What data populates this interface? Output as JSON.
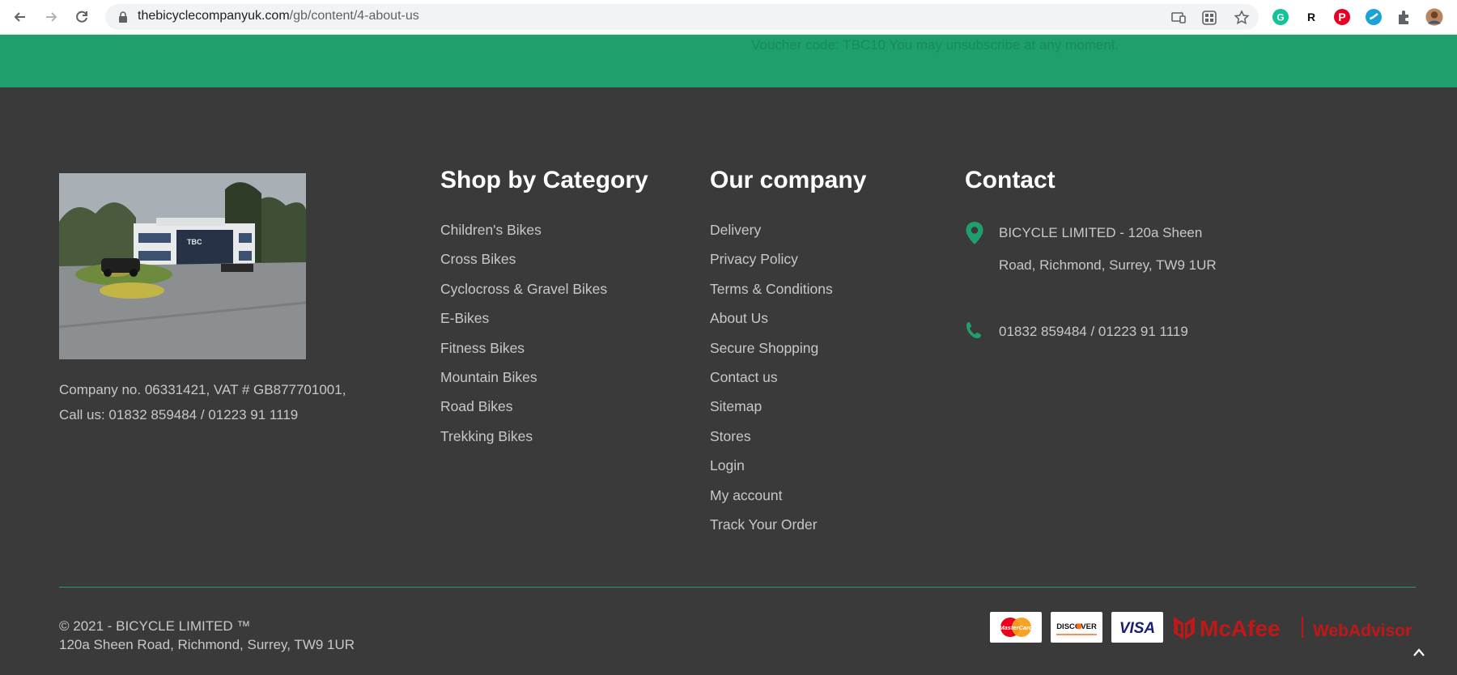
{
  "browser": {
    "url_host": "thebicyclecompanyuk.com",
    "url_path": "/gb/content/4-about-us"
  },
  "newsletter": {
    "voucher_text": "Voucher code: TBC10 You may unsubscribe at any moment."
  },
  "footer": {
    "company_info": [
      "Company no. 06331421, VAT # GB877701001,",
      "Call us: 01832 859484 / 01223 91 1119"
    ],
    "shop_by_category": {
      "title": "Shop by Category",
      "items": [
        "Children's Bikes",
        "Cross Bikes",
        "Cyclocross & Gravel Bikes",
        "E-Bikes",
        "Fitness Bikes",
        "Mountain Bikes",
        "Road Bikes",
        "Trekking Bikes"
      ]
    },
    "our_company": {
      "title": "Our company",
      "items": [
        "Delivery",
        "Privacy Policy",
        "Terms & Conditions",
        "About Us",
        "Secure Shopping",
        "Contact us",
        "Sitemap",
        "Stores",
        "Login",
        "My account",
        "Track Your Order"
      ]
    },
    "contact": {
      "title": "Contact",
      "address": "BICYCLE LIMITED - 120a Sheen Road, Richmond, Surrey, TW9 1UR",
      "phone": "01832 859484 / 01223 91 1119"
    },
    "copyright": {
      "line1": "© 2021 - BICYCLE LIMITED ™",
      "line2": "120a Sheen Road, Richmond, Surrey, TW9 1UR"
    },
    "payments": {
      "mastercard": "MasterCard",
      "discover": "DISCOVER",
      "visa": "VISA",
      "mcafee": "McAfee",
      "webadvisor": "WebAdvisor"
    }
  },
  "colors": {
    "accent_green": "#1e9f6b",
    "footer_bg": "#3a3a3a",
    "mcafee_red": "#c01818"
  }
}
